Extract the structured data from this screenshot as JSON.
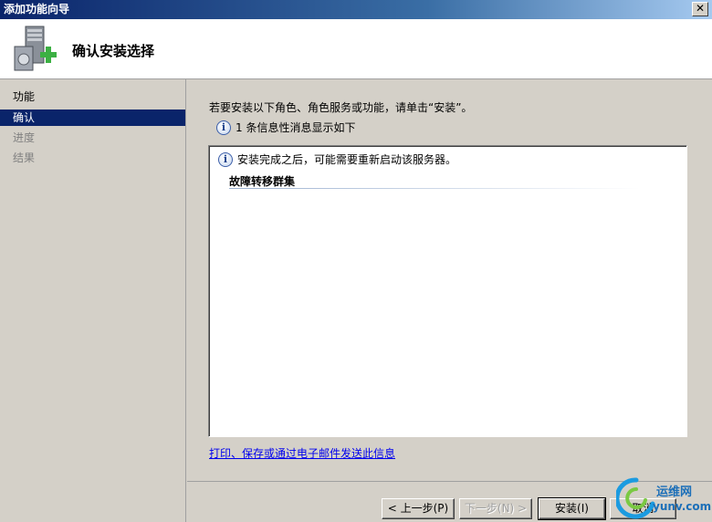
{
  "window": {
    "title": "添加功能向导",
    "close_glyph": "✕"
  },
  "header": {
    "title": "确认安装选择",
    "icon": "server-add-icon"
  },
  "sidebar": {
    "items": [
      {
        "label": "功能",
        "state": "done"
      },
      {
        "label": "确认",
        "state": "active"
      },
      {
        "label": "进度",
        "state": "pending"
      },
      {
        "label": "结果",
        "state": "pending"
      }
    ]
  },
  "main": {
    "instruction": "若要安装以下角色、角色服务或功能，请单击“安装”。",
    "info_summary": "1 条信息性消息显示如下",
    "results": {
      "note": "安装完成之后，可能需要重新启动该服务器。",
      "feature": "故障转移群集"
    },
    "print_link": "打印、保存或通过电子邮件发送此信息"
  },
  "buttons": {
    "prev": "< 上一步(P)",
    "next": "下一步(N) >",
    "install": "安装(I)",
    "cancel": "取消"
  },
  "watermark": {
    "line1": "运维网",
    "line2": "yunv.com"
  },
  "colors": {
    "title_bar": "#0a246a",
    "selection": "#0a246a",
    "link": "#0000ee"
  }
}
